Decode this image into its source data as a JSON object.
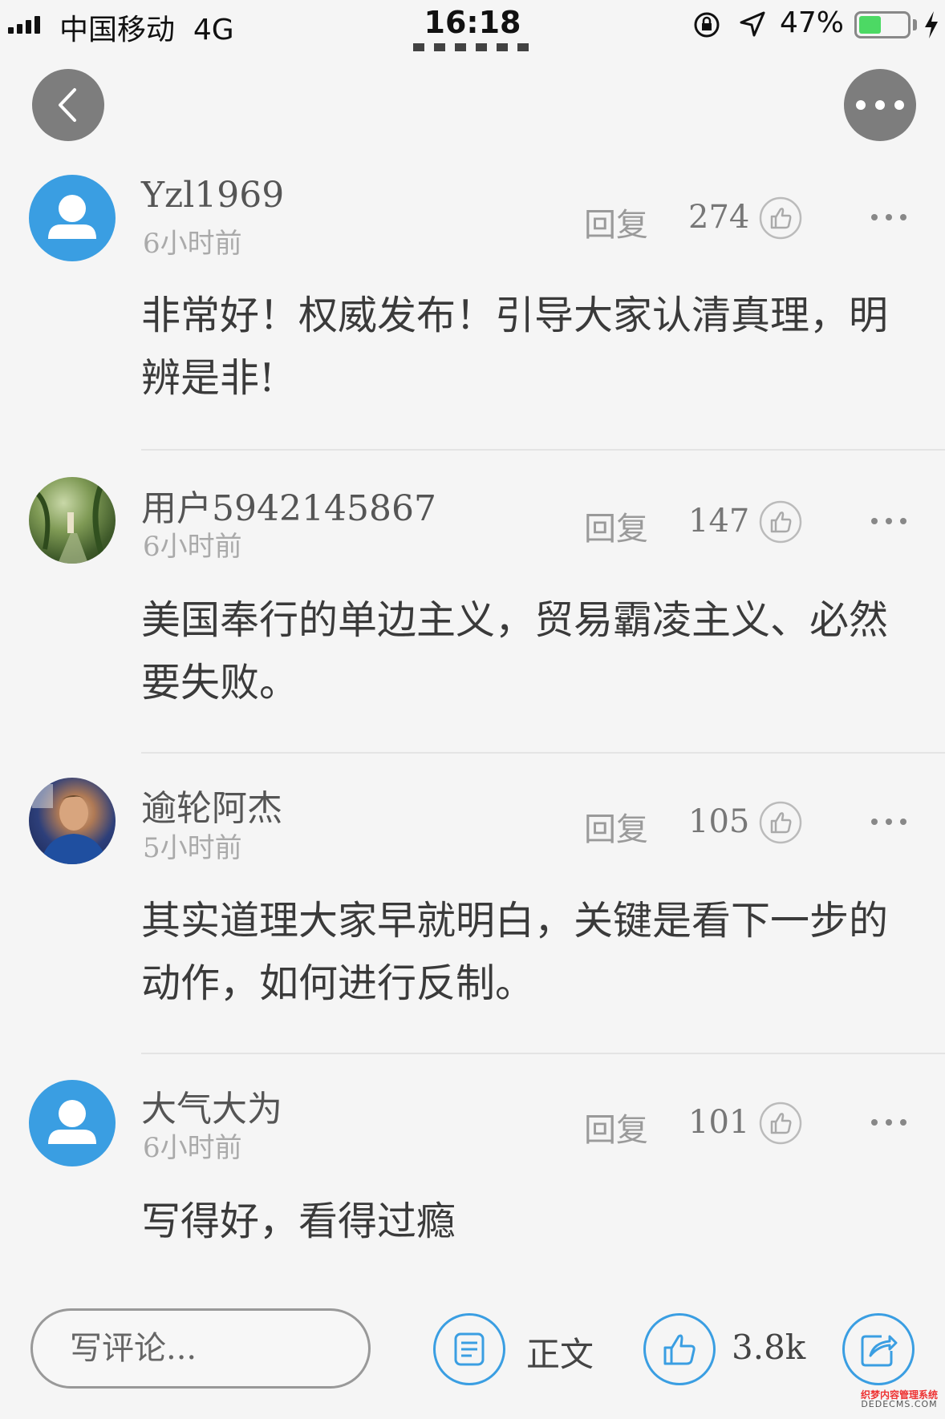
{
  "status_bar": {
    "carrier": "中国移动",
    "network": "4G",
    "time": "16:18",
    "battery_percent_text": "47%",
    "battery_level": 0.47,
    "icons": [
      "signal-icon",
      "rotation-lock-icon",
      "location-icon",
      "battery-icon",
      "charging-icon"
    ]
  },
  "nav": {
    "back_icon": "chevron-left-icon",
    "more_icon": "more-dots-icon"
  },
  "comments": [
    {
      "username": "Yzl1969",
      "time": "6小时前",
      "reply_label": "回复",
      "likes": "274",
      "content": "非常好！权威发布！引导大家认清真理，明辨是非!",
      "avatar": "default-user-avatar"
    },
    {
      "username": "用户5942145867",
      "time": "6小时前",
      "reply_label": "回复",
      "likes": "147",
      "content": "美国奉行的单边主义，贸易霸凌主义、必然要失败。",
      "avatar": "forest-photo-avatar"
    },
    {
      "username": "逾轮阿杰",
      "time": "5小时前",
      "reply_label": "回复",
      "likes": "105",
      "content": "其实道理大家早就明白，关键是看下一步的动作，如何进行反制。",
      "avatar": "football-player-photo-avatar"
    },
    {
      "username": "大气大为",
      "time": "6小时前",
      "reply_label": "回复",
      "likes": "101",
      "content": "写得好，看得过瘾",
      "avatar": "default-user-avatar"
    }
  ],
  "bottom_bar": {
    "comment_placeholder": "写评论...",
    "article_label": "正文",
    "total_likes": "3.8k",
    "icons": [
      "article-icon",
      "thumbs-up-icon",
      "share-icon"
    ]
  },
  "watermark": {
    "line1": "织梦内容管理系统",
    "line2": "DEDECMS.COM"
  },
  "colors": {
    "accent": "#3a9ee2",
    "background": "#f5f5f5",
    "nav_button": "#7d7d7d",
    "battery_fill": "#4cd964"
  }
}
